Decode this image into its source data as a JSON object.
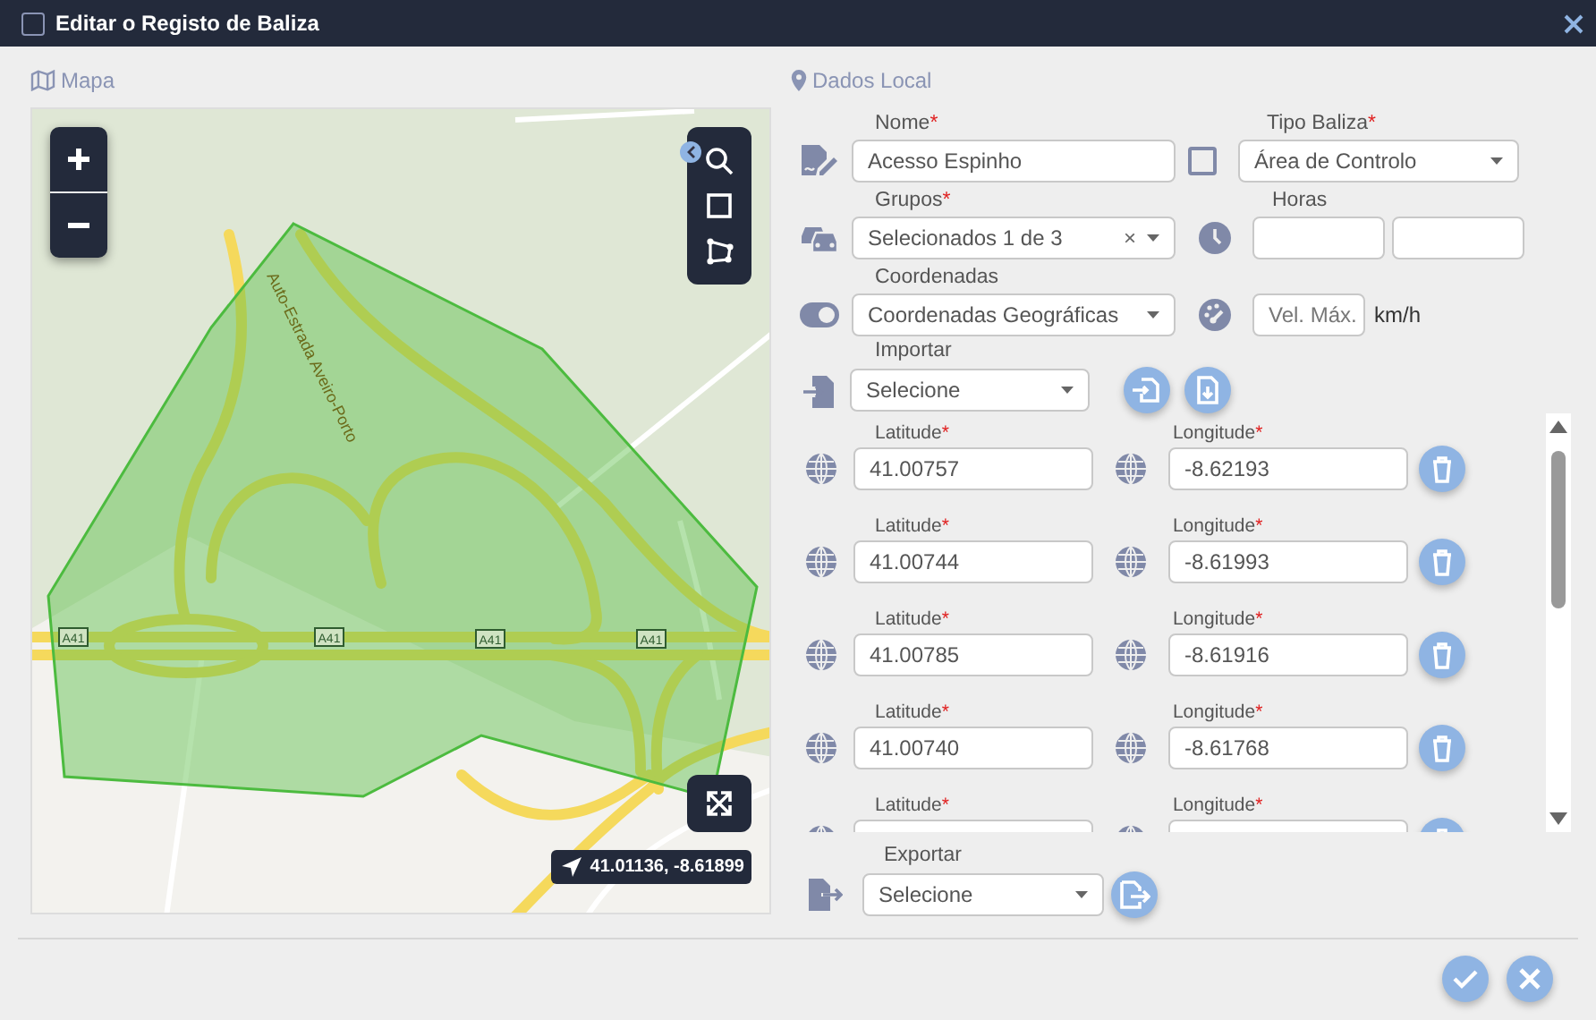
{
  "window": {
    "title": "Editar o Registo de Baliza"
  },
  "map_panel": {
    "heading": "Mapa",
    "map": {
      "road_labels": [
        {
          "kind": "road-name",
          "text": "Auto-Estrada Aveiro-Porto"
        },
        {
          "kind": "shield",
          "text": "A41"
        },
        {
          "kind": "shield",
          "text": "A41"
        },
        {
          "kind": "shield",
          "text": "A41"
        },
        {
          "kind": "shield",
          "text": "A41"
        }
      ],
      "coordinates": "41.01136, -8.61899"
    }
  },
  "form": {
    "heading": "Dados Local",
    "nome": {
      "label": {
        "text": "Nome",
        "required_mark": "*"
      },
      "value": "Acesso Espinho"
    },
    "tipo_baliza": {
      "label": {
        "text": "Tipo Baliza",
        "required_mark": "*"
      },
      "checked": false,
      "value": "Área de Controlo"
    },
    "grupos": {
      "label": {
        "text": "Grupos",
        "required_mark": "*"
      },
      "value": "Selecionados 1 de 3",
      "clear": "×"
    },
    "horas": {
      "label": {
        "text": "Horas"
      }
    },
    "coordenadas": {
      "label": {
        "text": "Coordenadas"
      },
      "value": "Coordenadas Geográficas"
    },
    "vel_max": {
      "placeholder": "Vel. Máx.",
      "unit": "km/h"
    },
    "importar": {
      "label": {
        "text": "Importar"
      },
      "value": "Selecione"
    },
    "points": [
      {
        "latitude_label": {
          "text": "Latitude",
          "required_mark": "*"
        },
        "longitude_label": {
          "text": "Longitude",
          "required_mark": "*"
        },
        "latitude": "41.00757",
        "longitude": "-8.62193"
      },
      {
        "latitude_label": {
          "text": "Latitude",
          "required_mark": "*"
        },
        "longitude_label": {
          "text": "Longitude",
          "required_mark": "*"
        },
        "latitude": "41.00744",
        "longitude": "-8.61993"
      },
      {
        "latitude_label": {
          "text": "Latitude",
          "required_mark": "*"
        },
        "longitude_label": {
          "text": "Longitude",
          "required_mark": "*"
        },
        "latitude": "41.00785",
        "longitude": "-8.61916"
      },
      {
        "latitude_label": {
          "text": "Latitude",
          "required_mark": "*"
        },
        "longitude_label": {
          "text": "Longitude",
          "required_mark": "*"
        },
        "latitude": "41.00740",
        "longitude": "-8.61768"
      },
      {
        "latitude_label": {
          "text": "Latitude",
          "required_mark": "*"
        },
        "longitude_label": {
          "text": "Longitude",
          "required_mark": "*"
        }
      }
    ],
    "exportar": {
      "label": {
        "text": "Exportar"
      },
      "value": "Selecione"
    }
  }
}
